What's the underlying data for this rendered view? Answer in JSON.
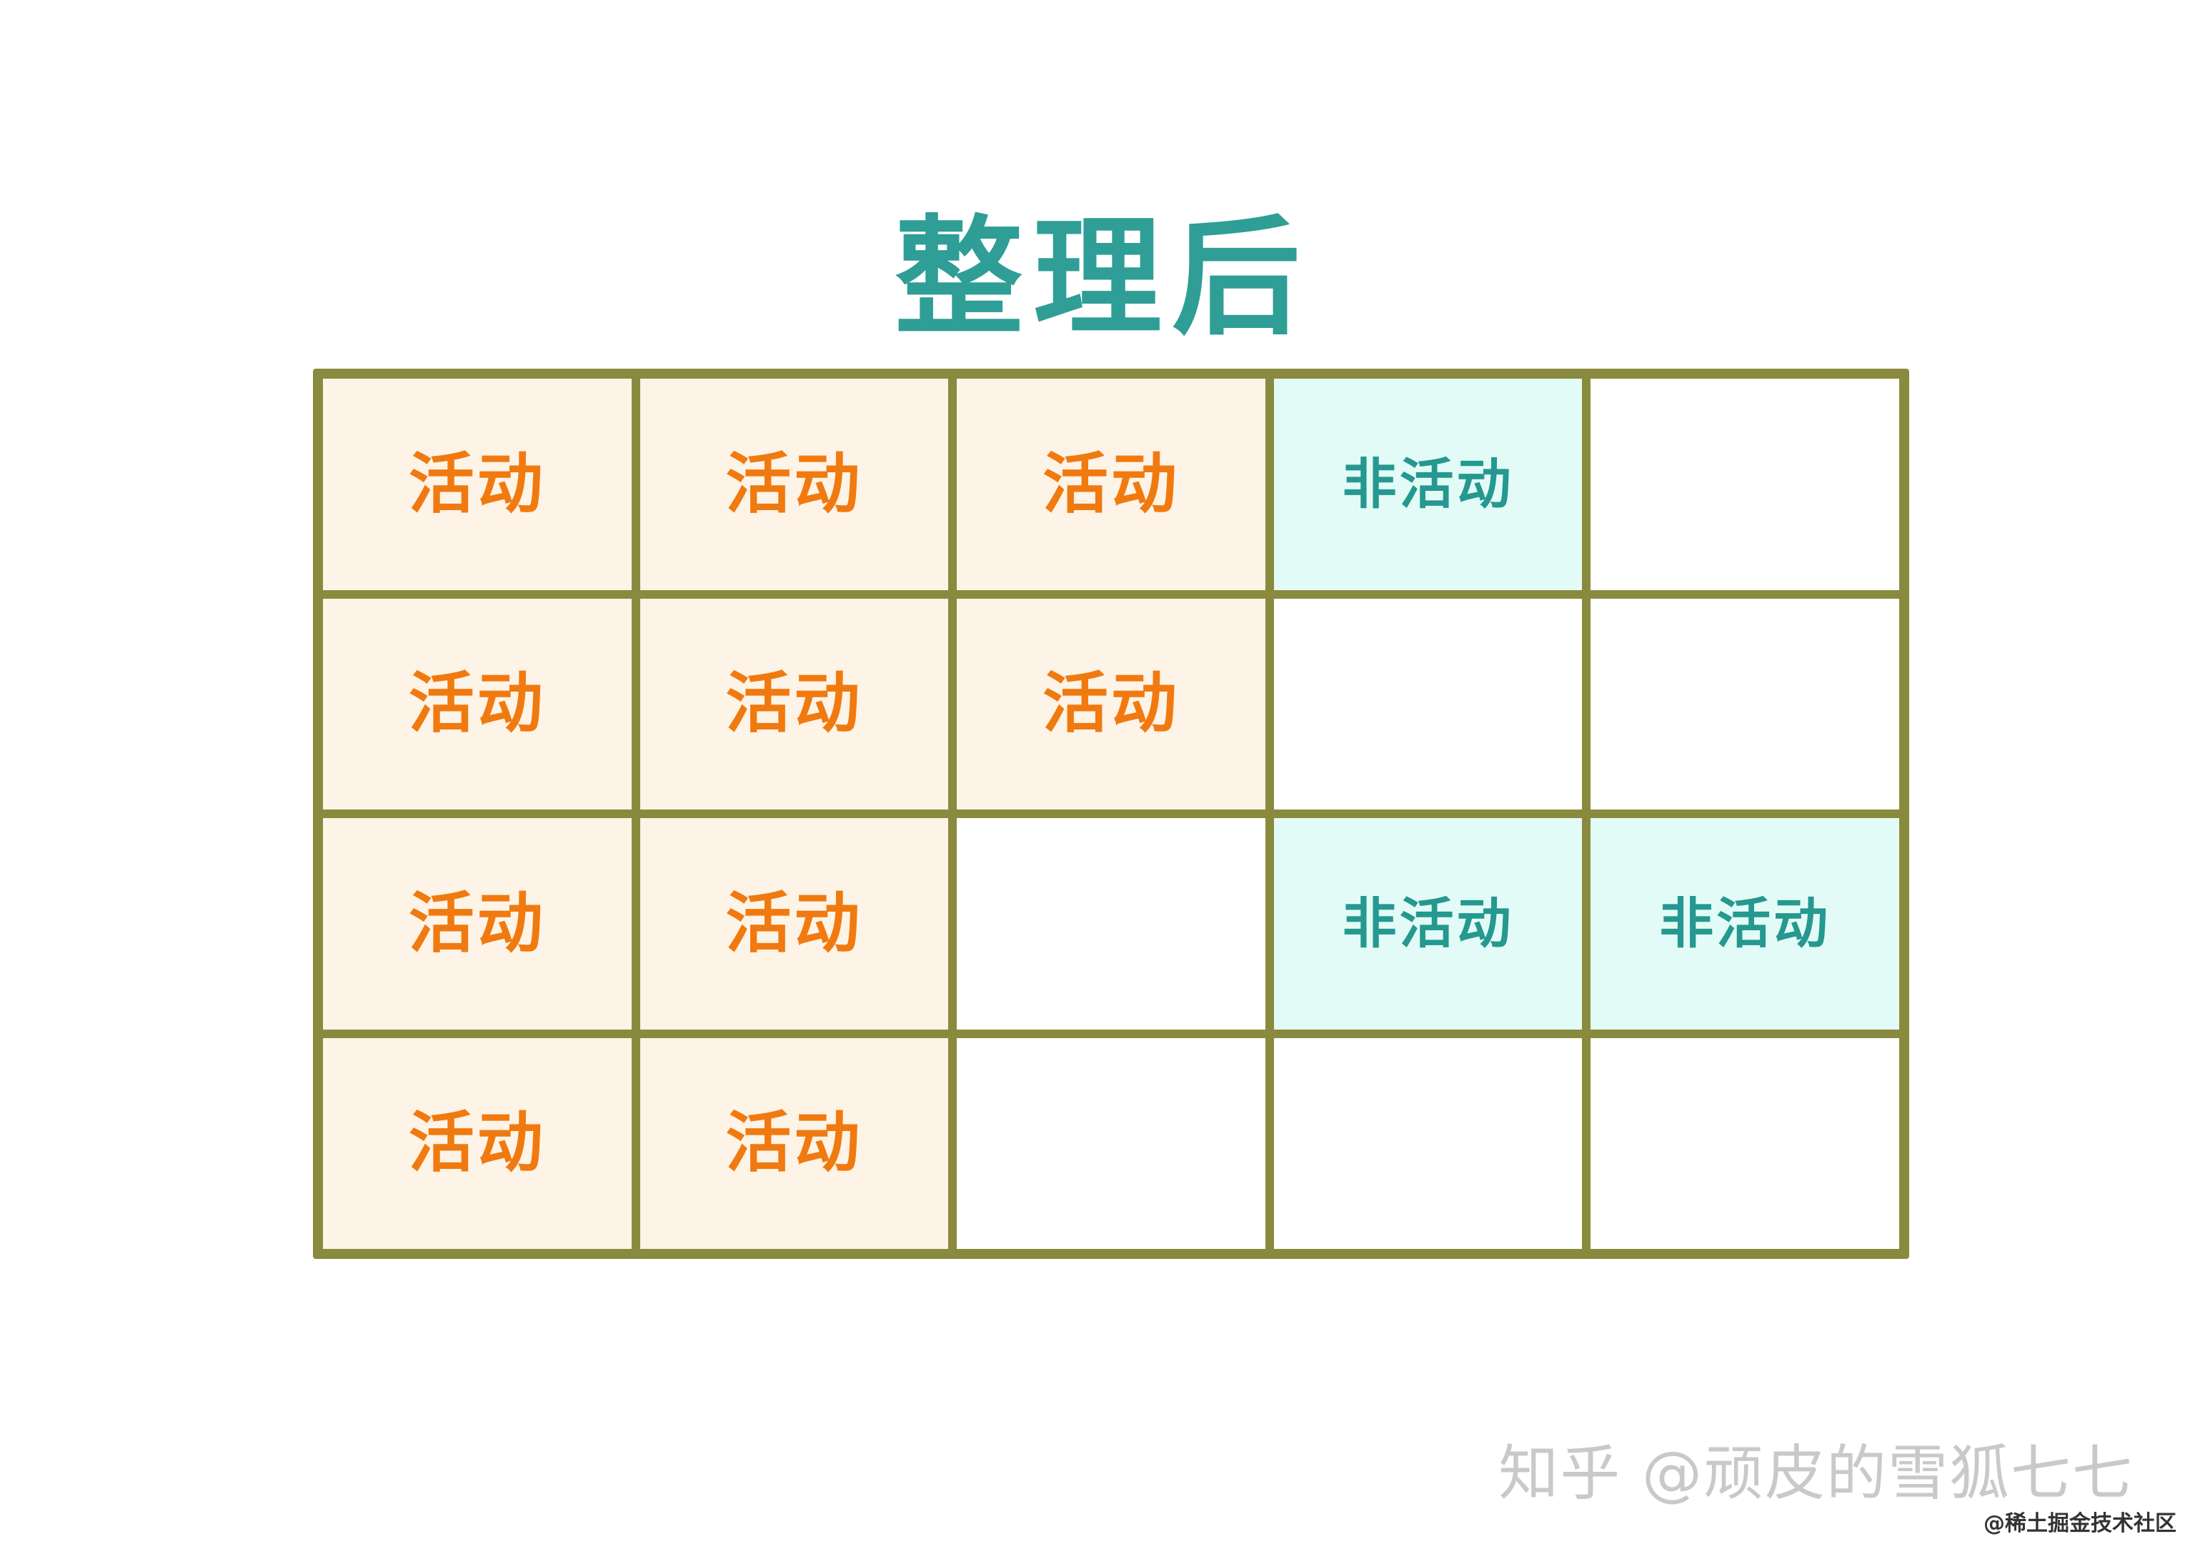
{
  "title": "整理后",
  "colors": {
    "title": "#2e9e96",
    "border": "#8a8a3e",
    "active_text": "#f07a10",
    "active_fill": "#fdf3e6",
    "inactive_text": "#25988f",
    "inactive_fill": "#e3fbf7",
    "empty_fill": "#ffffff"
  },
  "labels": {
    "active": "活动",
    "inactive": "非活动"
  },
  "grid": {
    "rows": 4,
    "cols": 5,
    "cells": [
      [
        "active",
        "active",
        "active",
        "inactive",
        "empty"
      ],
      [
        "active",
        "active",
        "active",
        "empty",
        "empty"
      ],
      [
        "active",
        "active",
        "empty",
        "inactive",
        "inactive"
      ],
      [
        "active",
        "active",
        "empty",
        "empty",
        "empty"
      ]
    ]
  },
  "watermark": "知乎 @顽皮的雪狐七七",
  "credit": "@稀土掘金技术社区"
}
